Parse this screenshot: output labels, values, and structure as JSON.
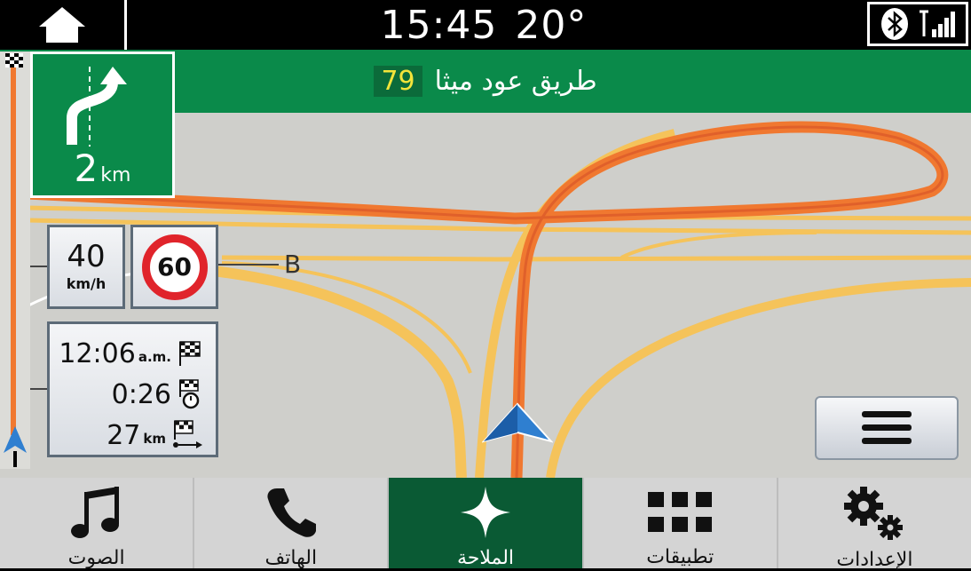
{
  "status_bar": {
    "time": "15:45",
    "temperature": "20°",
    "icons": [
      "home-icon",
      "bluetooth-icon",
      "signal-icon"
    ]
  },
  "street": {
    "name": "طريق عود ميثا",
    "road_number": "79"
  },
  "turn": {
    "distance_value": "2",
    "distance_unit": "km",
    "icon": "keep-right-icon"
  },
  "speed": {
    "current_value": "40",
    "current_unit": "km/h",
    "limit_value": "60"
  },
  "callout_label": "B",
  "trip": {
    "arrival_time": "12:06",
    "arrival_suffix": "a.m.",
    "remaining_time": "0:26",
    "remaining_distance": "27",
    "remaining_distance_unit": "km"
  },
  "bottom_nav": {
    "items": [
      {
        "label": "الصوت",
        "icon": "music-note-icon",
        "active": false
      },
      {
        "label": "الهاتف",
        "icon": "phone-icon",
        "active": false
      },
      {
        "label": "الملاحة",
        "icon": "compass-star-icon",
        "active": true
      },
      {
        "label": "تطبيقات",
        "icon": "apps-grid-icon",
        "active": false
      },
      {
        "label": "الإعدادات",
        "icon": "gear-icon",
        "active": false
      }
    ]
  },
  "colors": {
    "accent_green": "#0a8a4a",
    "route_orange": "#f07830",
    "road_yellow": "#f5c35a",
    "speed_limit_red": "#e0242b"
  }
}
